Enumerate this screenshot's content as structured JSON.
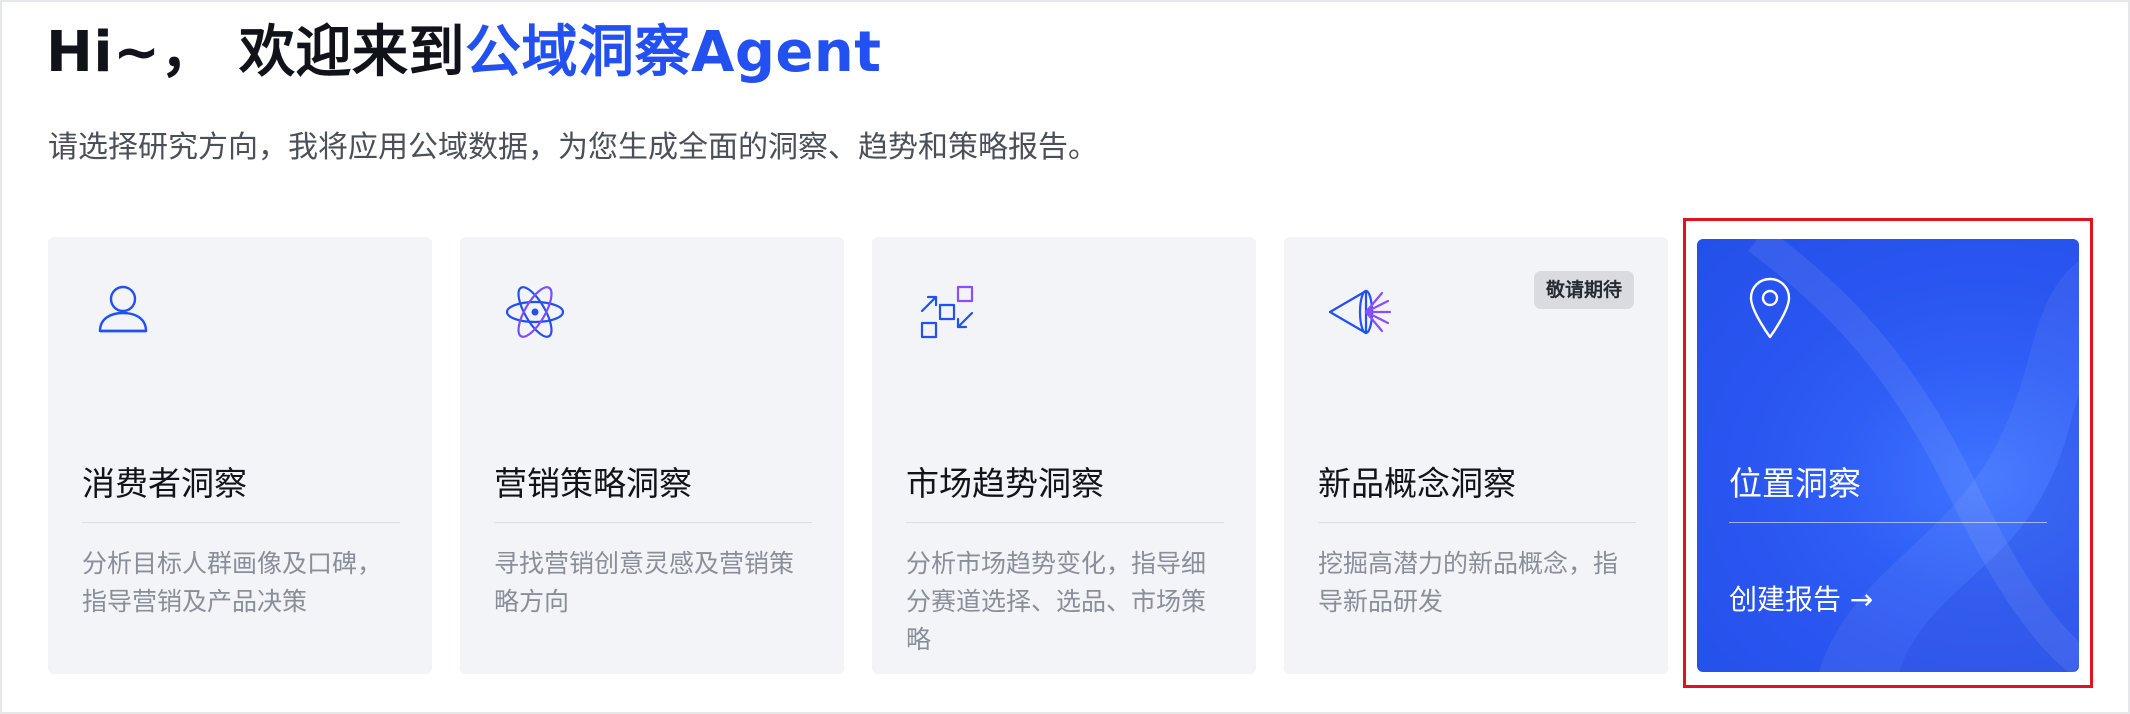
{
  "header": {
    "greeting": "Hi~，",
    "welcome": "欢迎来到",
    "brand": "公域洞察Agent",
    "subtitle": "请选择研究方向，我将应用公域数据，为您生成全面的洞察、趋势和策略报告。"
  },
  "colors": {
    "accent": "#2350f0",
    "card_bg": "#f3f4f7",
    "active_card_bg": "#2a55f0",
    "highlight_border": "#e0141c"
  },
  "cards": [
    {
      "icon": "user-icon",
      "title": "消费者洞察",
      "description": "分析目标人群画像及口碑，指导营销及产品决策"
    },
    {
      "icon": "atom-icon",
      "title": "营销策略洞察",
      "description": "寻找营销创意灵感及营销策略方向"
    },
    {
      "icon": "trend-arrows-icon",
      "title": "市场趋势洞察",
      "description": "分析市场趋势变化，指导细分赛道选择、选品、市场策略"
    },
    {
      "icon": "cone-beam-icon",
      "title": "新品概念洞察",
      "description": "挖掘高潜力的新品概念，指导新品研发",
      "badge": "敬请期待"
    },
    {
      "icon": "location-pin-icon",
      "title": "位置洞察",
      "cta": "创建报告 →",
      "selected": true
    }
  ]
}
